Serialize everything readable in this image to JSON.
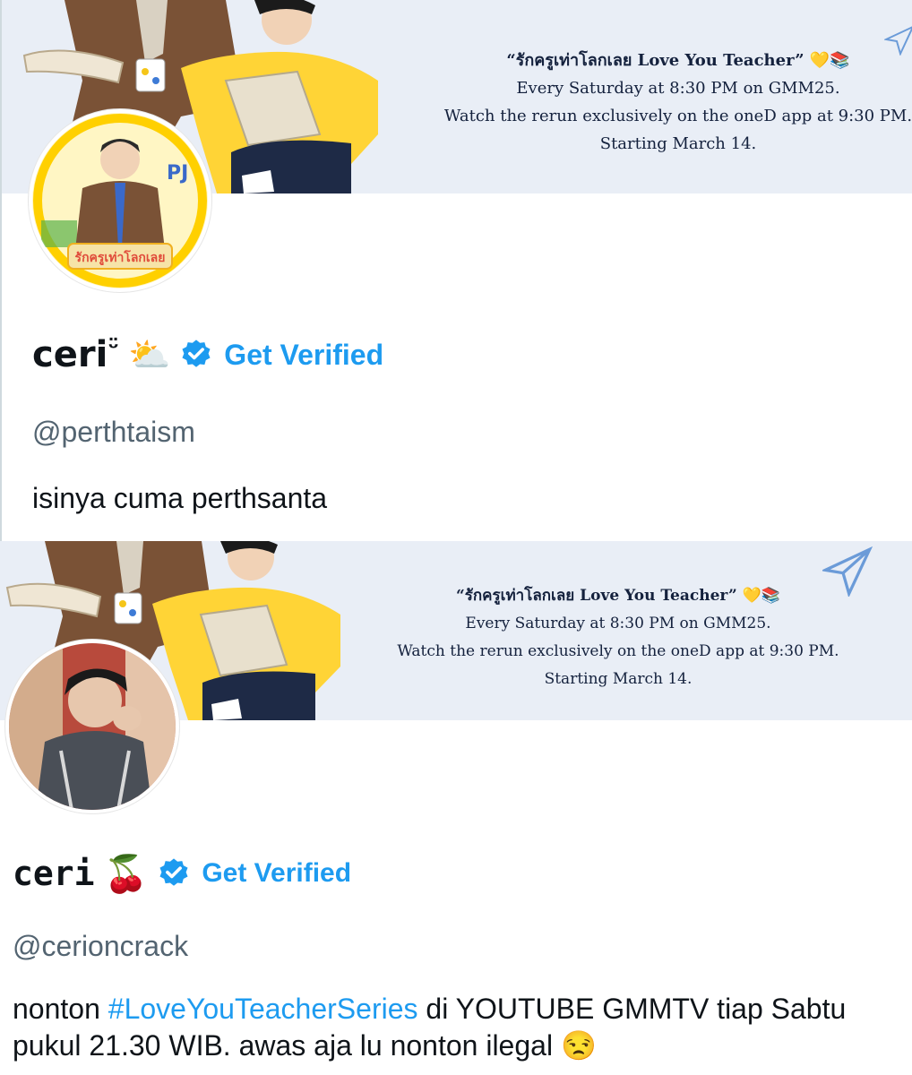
{
  "panels": [
    {
      "banner": {
        "promo_title": "“รักครูเท่าโลกเลย Love You Teacher” 💛📚",
        "promo_line1": "Every Saturday at 8:30 PM on GMM25.",
        "promo_line2": "Watch the rerun exclusively on the oneD app at 9:30 PM.",
        "promo_line3": "Starting March 14."
      },
      "profile": {
        "display_name": "ceri",
        "name_suffix": "ᵕ̈",
        "emoji": "⛅",
        "verified_icon": "verified-badge-icon",
        "get_verified_label": "Get Verified",
        "handle": "@perthtaism",
        "bio": "isinya cuma perthsanta"
      }
    },
    {
      "banner": {
        "promo_title": "“รักครูเท่าโลกเลย Love You Teacher” 💛📚",
        "promo_line1": "Every Saturday at 8:30 PM on GMM25.",
        "promo_line2": "Watch the rerun exclusively on the oneD app at 9:30 PM.",
        "promo_line3": "Starting March 14."
      },
      "profile": {
        "display_name": "ceri",
        "emoji": "🍒",
        "verified_icon": "verified-badge-icon",
        "get_verified_label": "Get Verified",
        "handle": "@cerioncrack",
        "bio_before": "nonton ",
        "bio_hashtag": "#LoveYouTeacherSeries",
        "bio_after": " di YOUTUBE GMMTV tiap Sabtu pukul 21.30 WIB. awas aja lu nonton ilegal 😒"
      }
    }
  ],
  "colors": {
    "accent": "#1d9bf0",
    "handle": "#536471",
    "banner_bg": "#e9eef6",
    "text": "#0f1419"
  }
}
